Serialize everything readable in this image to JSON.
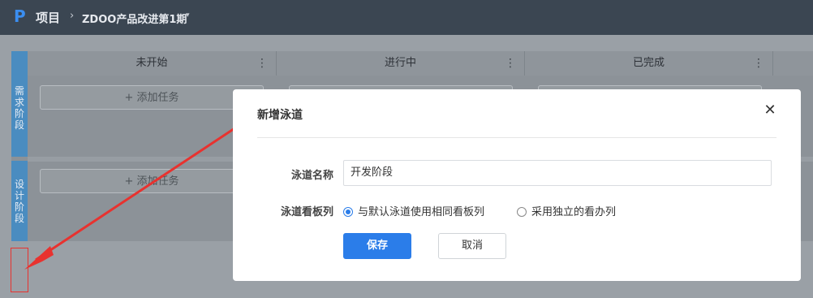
{
  "topbar": {
    "logo": "P",
    "project_label": "项目",
    "separator": "›",
    "execution_name": "ZDOO产品改进第1期",
    "caret": "▾"
  },
  "board": {
    "columns": [
      {
        "title": "未开始",
        "more": "⋮"
      },
      {
        "title": "进行中",
        "more": "⋮"
      },
      {
        "title": "已完成",
        "more": "⋮"
      }
    ],
    "lanes": [
      {
        "label_chars": [
          "需",
          "求",
          "阶",
          "段"
        ],
        "add_label": "+ 添加任务"
      },
      {
        "label_chars": [
          "设",
          "计",
          "阶",
          "段"
        ],
        "add_label": "+ 添加任务"
      }
    ]
  },
  "modal": {
    "title": "新增泳道",
    "close_icon": "✕",
    "name_label": "泳道名称",
    "name_value": "开发阶段",
    "column_label": "泳道看板列",
    "radio_options": [
      {
        "label": "与默认泳道使用相同看板列",
        "selected": true
      },
      {
        "label": "采用独立的看办列",
        "selected": false
      }
    ],
    "save_label": "保存",
    "cancel_label": "取消"
  },
  "colors": {
    "accent": "#2b7de9",
    "lane_label": "#4a8cc0",
    "annotation_red": "#e8322f"
  }
}
